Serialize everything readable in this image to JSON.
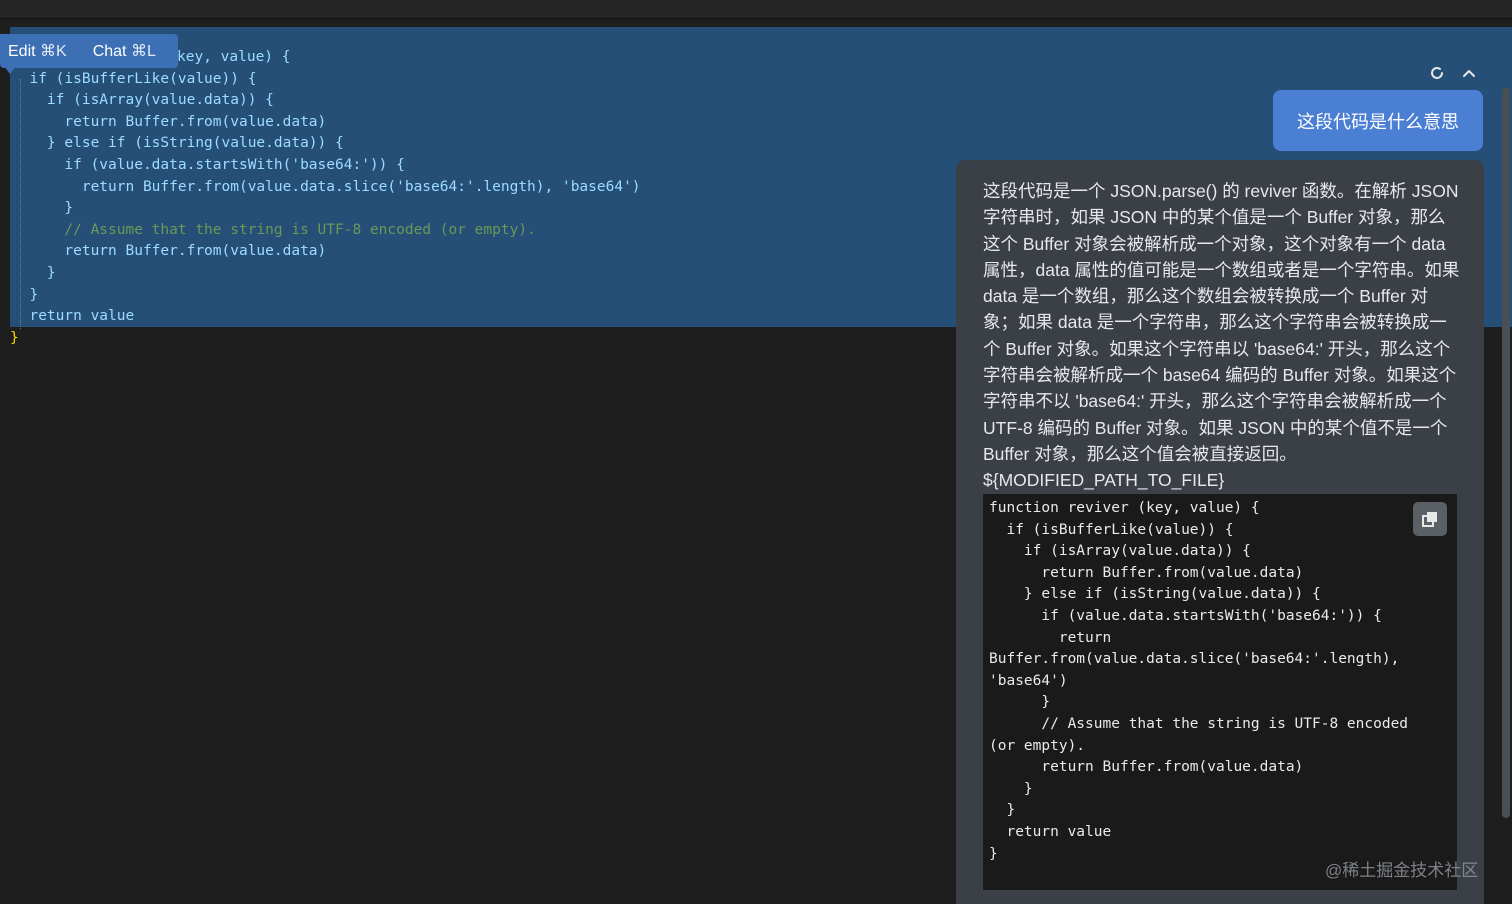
{
  "popup": {
    "edit_label": "Edit",
    "edit_shortcut": "⌘K",
    "chat_label": "Chat",
    "chat_shortcut": "⌘L"
  },
  "editor": {
    "lines": [
      "key, value) {",
      "  if (isBufferLike(value)) {",
      "    if (isArray(value.data)) {",
      "      return Buffer.from(value.data)",
      "    } else if (isString(value.data)) {",
      "      if (value.data.startsWith('base64:')) {",
      "        return Buffer.from(value.data.slice('base64:'.length), 'base64')",
      "      }",
      "      // Assume that the string is UTF-8 encoded (or empty).",
      "      return Buffer.from(value.data)",
      "    }",
      "  }",
      "  return value",
      "}"
    ]
  },
  "chat": {
    "controls": {
      "refresh_icon": "refresh-icon",
      "collapse_icon": "chevron-up-icon"
    },
    "user_message": "这段代码是什么意思",
    "answer_text": "这段代码是一个 JSON.parse() 的 reviver 函数。在解析 JSON 字符串时，如果 JSON 中的某个值是一个 Buffer 对象，那么这个 Buffer 对象会被解析成一个对象，这个对象有一个 data 属性，data 属性的值可能是一个数组或者是一个字符串。如果 data 是一个数组，那么这个数组会被转换成一个 Buffer 对象；如果 data 是一个字符串，那么这个字符串会被转换成一个 Buffer 对象。如果这个字符串以 'base64:' 开头，那么这个字符串会被解析成一个 base64 编码的 Buffer 对象。如果这个字符串不以 'base64:' 开头，那么这个字符串会被解析成一个 UTF-8 编码的 Buffer 对象。如果 JSON 中的某个值不是一个 Buffer 对象，那么这个值会被直接返回。",
    "answer_placeholder": "${MODIFIED_PATH_TO_FILE}",
    "answer_code": "function reviver (key, value) {\n  if (isBufferLike(value)) {\n    if (isArray(value.data)) {\n      return Buffer.from(value.data)\n    } else if (isString(value.data)) {\n      if (value.data.startsWith('base64:')) {\n        return\nBuffer.from(value.data.slice('base64:'.length),\n'base64')\n      }\n      // Assume that the string is UTF-8 encoded\n(or empty).\n      return Buffer.from(value.data)\n    }\n  }\n  return value\n}",
    "copy_icon": "copy-icon"
  },
  "watermark": "@稀土掘金技术社区",
  "colors": {
    "editor_bg": "#1e1e1e",
    "selection": "#264f78",
    "popup_bg": "#3d6fb5",
    "user_bubble": "#4a7fd3",
    "answer_card": "#3b3f46",
    "code_block_bg": "#1a1a1a"
  }
}
